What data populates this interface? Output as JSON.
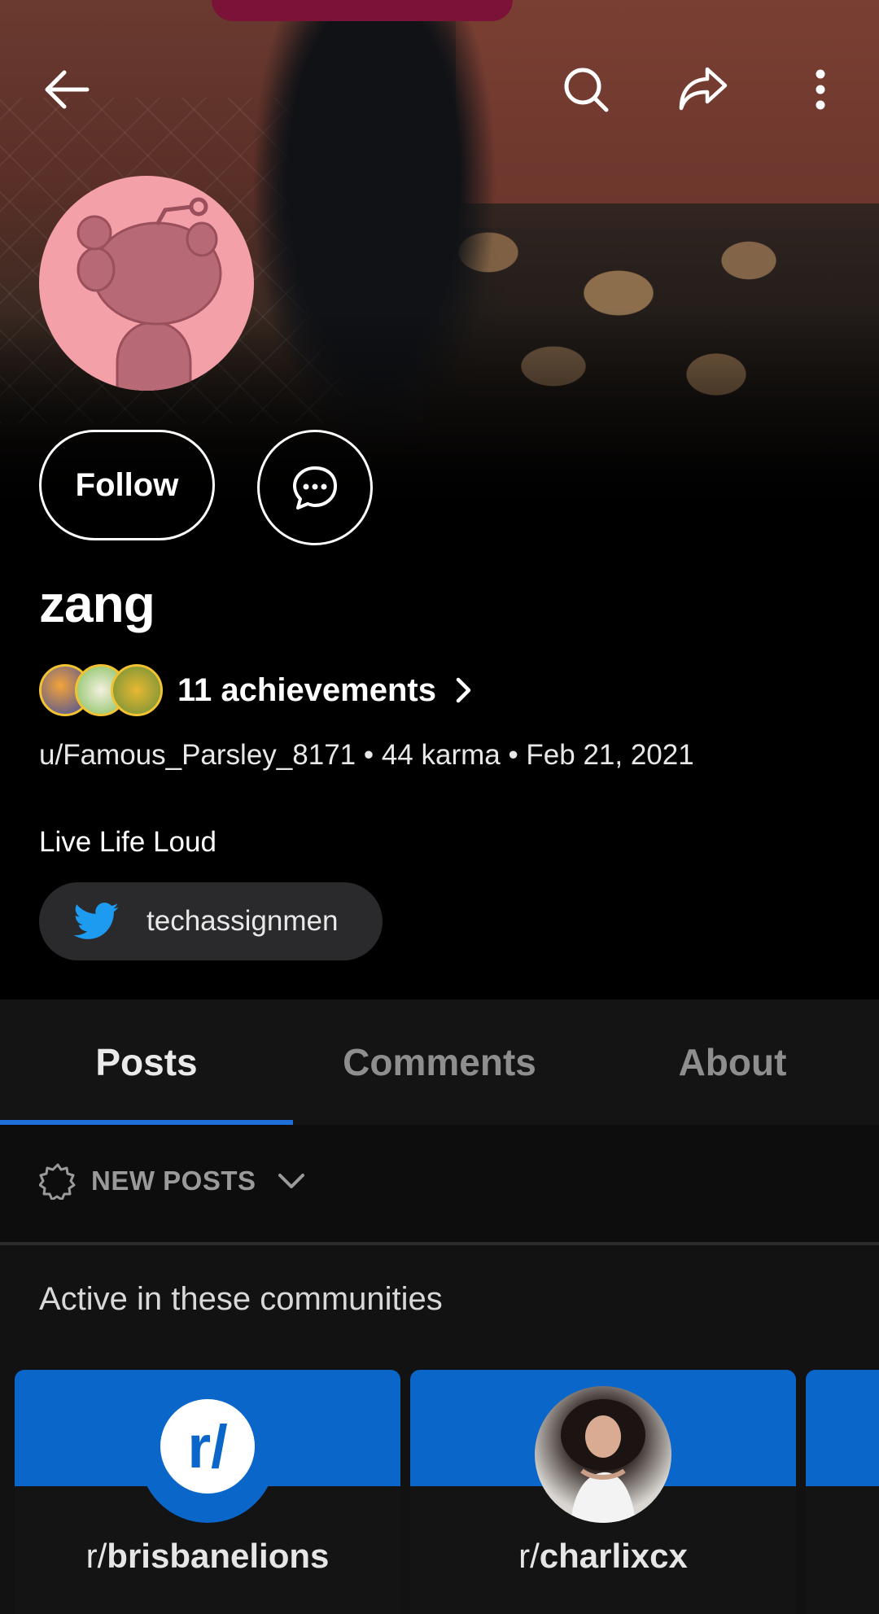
{
  "user": {
    "display_name": "zang",
    "achievements_label": "11 achievements",
    "meta_line": "u/Famous_Parsley_8171 • 44 karma • Feb 21, 2021",
    "bio": "Live Life Loud",
    "social_link": "techassignmen"
  },
  "actions": {
    "follow_label": "Follow"
  },
  "tabs": [
    {
      "label": "Posts",
      "active": true
    },
    {
      "label": "Comments",
      "active": false
    },
    {
      "label": "About",
      "active": false
    }
  ],
  "sort": {
    "label": "NEW POSTS"
  },
  "communities": {
    "title": "Active in these communities",
    "items": [
      {
        "prefix": "r/",
        "name": "brisbanelions",
        "icon": "reddit-default-community-icon"
      },
      {
        "prefix": "r/",
        "name": "charlixcx",
        "icon": "community-photo-avatar"
      }
    ]
  },
  "colors": {
    "accent": "#1e6fd9",
    "community_banner": "#0a66c9",
    "avatar_bg": "#f4a0a8",
    "twitter": "#1d9bf0"
  }
}
